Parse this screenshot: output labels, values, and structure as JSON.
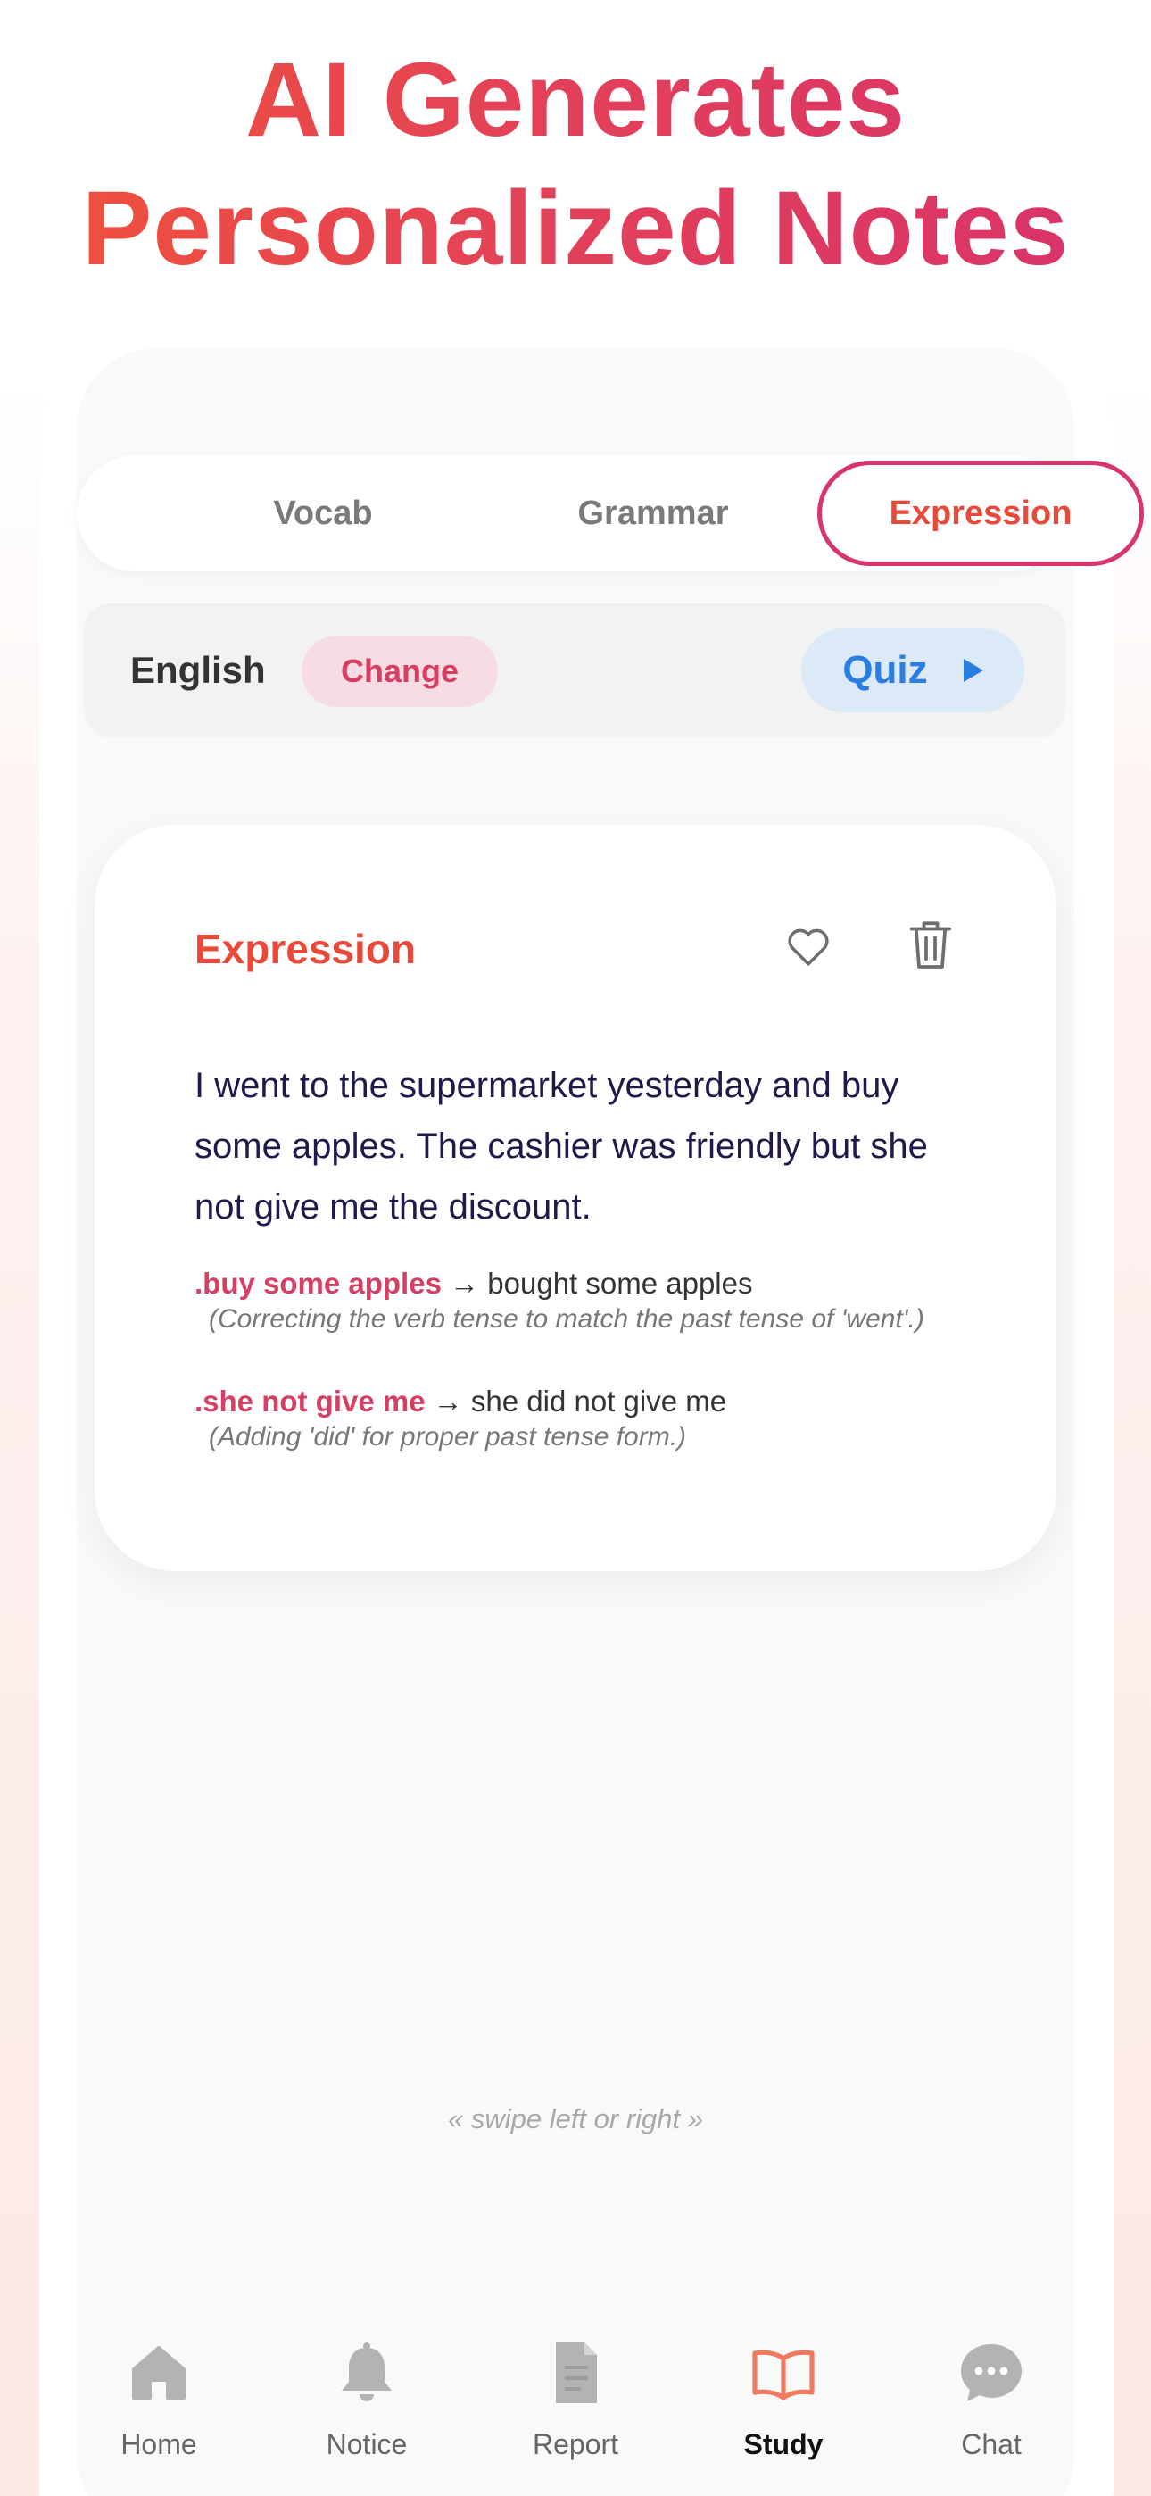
{
  "headline": {
    "line1": "AI Generates",
    "line2": "Personalized Notes"
  },
  "tabs": [
    {
      "label": "Vocab",
      "active": false
    },
    {
      "label": "Grammar",
      "active": false
    },
    {
      "label": "Expression",
      "active": true
    }
  ],
  "language_bar": {
    "language": "English",
    "change_label": "Change",
    "quiz_label": "Quiz"
  },
  "card": {
    "title": "Expression",
    "sentence": "I went to the supermarket yesterday and buy some apples. The cashier was friendly but she not give me the discount.",
    "corrections": [
      {
        "bullet": ".",
        "wrong": "buy some apples",
        "arrow": "→",
        "right": "bought some apples",
        "reason": "(Correcting the verb tense to match the past tense of 'went'.)"
      },
      {
        "bullet": ".",
        "wrong": "she not give me",
        "arrow": "→",
        "right": "she did not give me",
        "reason": "(Adding 'did' for proper past tense form.)"
      }
    ]
  },
  "swipe_hint": "« swipe left or right »",
  "nav": [
    {
      "label": "Home",
      "icon": "home-icon",
      "active": false
    },
    {
      "label": "Notice",
      "icon": "bell-icon",
      "active": false
    },
    {
      "label": "Report",
      "icon": "document-icon",
      "active": false
    },
    {
      "label": "Study",
      "icon": "book-icon",
      "active": true
    },
    {
      "label": "Chat",
      "icon": "chat-icon",
      "active": false
    }
  ],
  "colors": {
    "accent_orange": "#e84a3a",
    "accent_pink": "#d63f63",
    "quiz_blue": "#2a7de1",
    "nav_inactive": "#b3b3b3",
    "nav_active_icon": "#f07a5e"
  }
}
